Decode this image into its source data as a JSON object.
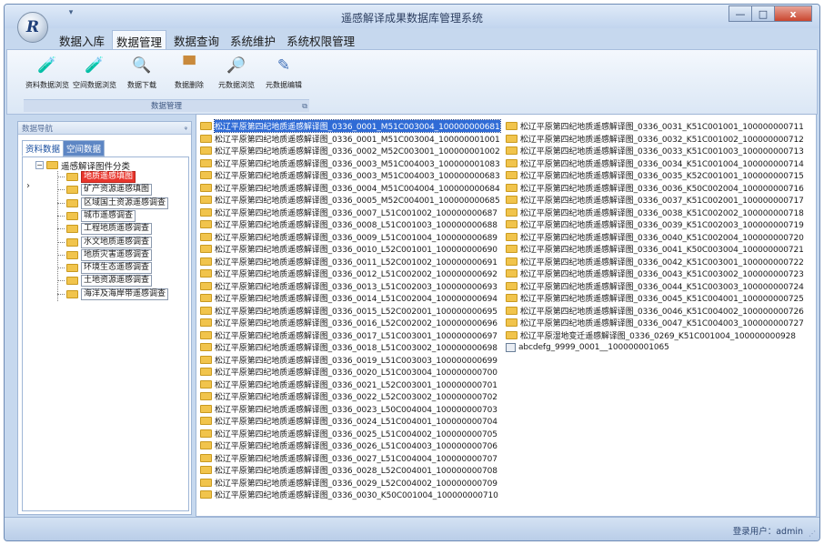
{
  "app": {
    "title": "遥感解译成果数据库管理系统",
    "logo_text": "R"
  },
  "window_buttons": {
    "minimize": "—",
    "maximize": "□",
    "close": "x"
  },
  "menu": {
    "items": [
      {
        "label": "数据入库",
        "active": false
      },
      {
        "label": "数据管理",
        "active": true
      },
      {
        "label": "数据查询",
        "active": false
      },
      {
        "label": "系统维护",
        "active": false
      },
      {
        "label": "系统权限管理",
        "active": false
      }
    ]
  },
  "ribbon": {
    "group_label": "数据管理",
    "tools": [
      {
        "label": "资料数据浏览",
        "icon": "data-browse-icon",
        "glyph": "🧪",
        "color": "#3f8f3f"
      },
      {
        "label": "空间数据浏览",
        "icon": "spatial-browse-icon",
        "glyph": "🧪",
        "color": "#3f8f3f"
      },
      {
        "label": "数据下载",
        "icon": "download-icon",
        "glyph": "🔍",
        "color": "#4f6f9f"
      },
      {
        "label": "数据删除",
        "icon": "delete-icon",
        "glyph": "▀",
        "color": "#c98a3c"
      },
      {
        "label": "元数据浏览",
        "icon": "metadata-browse-icon",
        "glyph": "🔎",
        "color": "#4f8f4f"
      },
      {
        "label": "元数据编辑",
        "icon": "metadata-edit-icon",
        "glyph": "✎",
        "color": "#3f6fb8"
      }
    ]
  },
  "nav": {
    "header": "数据导航",
    "pin": "ᵩ",
    "tabs": [
      "资料数据",
      "空间数据"
    ],
    "tree_root": "遥感解译图件分类",
    "tree_items": [
      {
        "label": "地质遥感填图",
        "selected": true
      },
      {
        "label": "矿产资源遥感填图",
        "selected": false
      },
      {
        "label": "区域国土资源遥感调查",
        "selected": false
      },
      {
        "label": "城市遥感调查",
        "selected": false
      },
      {
        "label": "工程地质遥感调查",
        "selected": false
      },
      {
        "label": "水文地质遥感调查",
        "selected": false
      },
      {
        "label": "地质灾害遥感调查",
        "selected": false
      },
      {
        "label": "环境生态遥感调查",
        "selected": false
      },
      {
        "label": "土地资源遥感调查",
        "selected": false
      },
      {
        "label": "海洋及海岸带遥感调查",
        "selected": false
      }
    ]
  },
  "files": {
    "column_1": [
      {
        "name": "松辽平原第四纪地质遥感解译图_0336_0001_M51C003004_100000000681",
        "type": "folder",
        "highlighted": true
      },
      {
        "name": "松辽平原第四纪地质遥感解译图_0336_0001_M51C003004_100000001001",
        "type": "folder"
      },
      {
        "name": "松辽平原第四纪地质遥感解译图_0336_0002_M52C003001_100000001002",
        "type": "folder"
      },
      {
        "name": "松辽平原第四纪地质遥感解译图_0336_0003_M51C004003_100000001083",
        "type": "folder"
      },
      {
        "name": "松辽平原第四纪地质遥感解译图_0336_0003_M51C004003_100000000683",
        "type": "folder"
      },
      {
        "name": "松辽平原第四纪地质遥感解译图_0336_0004_M51C004004_100000000684",
        "type": "folder"
      },
      {
        "name": "松辽平原第四纪地质遥感解译图_0336_0005_M52C004001_100000000685",
        "type": "folder"
      },
      {
        "name": "松辽平原第四纪地质遥感解译图_0336_0007_L51C001002_100000000687",
        "type": "folder"
      },
      {
        "name": "松辽平原第四纪地质遥感解译图_0336_0008_L51C001003_100000000688",
        "type": "folder"
      },
      {
        "name": "松辽平原第四纪地质遥感解译图_0336_0009_L51C001004_100000000689",
        "type": "folder"
      },
      {
        "name": "松辽平原第四纪地质遥感解译图_0336_0010_L52C001001_100000000690",
        "type": "folder"
      },
      {
        "name": "松辽平原第四纪地质遥感解译图_0336_0011_L52C001002_100000000691",
        "type": "folder"
      },
      {
        "name": "松辽平原第四纪地质遥感解译图_0336_0012_L51C002002_100000000692",
        "type": "folder"
      },
      {
        "name": "松辽平原第四纪地质遥感解译图_0336_0013_L51C002003_100000000693",
        "type": "folder"
      },
      {
        "name": "松辽平原第四纪地质遥感解译图_0336_0014_L51C002004_100000000694",
        "type": "folder"
      },
      {
        "name": "松辽平原第四纪地质遥感解译图_0336_0015_L52C002001_100000000695",
        "type": "folder"
      },
      {
        "name": "松辽平原第四纪地质遥感解译图_0336_0016_L52C002002_100000000696",
        "type": "folder"
      },
      {
        "name": "松辽平原第四纪地质遥感解译图_0336_0017_L51C003001_100000000697",
        "type": "folder"
      },
      {
        "name": "松辽平原第四纪地质遥感解译图_0336_0018_L51C003002_100000000698",
        "type": "folder"
      },
      {
        "name": "松辽平原第四纪地质遥感解译图_0336_0019_L51C003003_100000000699",
        "type": "folder"
      },
      {
        "name": "松辽平原第四纪地质遥感解译图_0336_0020_L51C003004_100000000700",
        "type": "folder"
      },
      {
        "name": "松辽平原第四纪地质遥感解译图_0336_0021_L52C003001_100000000701",
        "type": "folder"
      },
      {
        "name": "松辽平原第四纪地质遥感解译图_0336_0022_L52C003002_100000000702",
        "type": "folder"
      },
      {
        "name": "松辽平原第四纪地质遥感解译图_0336_0023_L50C004004_100000000703",
        "type": "folder"
      },
      {
        "name": "松辽平原第四纪地质遥感解译图_0336_0024_L51C004001_100000000704",
        "type": "folder"
      },
      {
        "name": "松辽平原第四纪地质遥感解译图_0336_0025_L51C004002_100000000705",
        "type": "folder"
      },
      {
        "name": "松辽平原第四纪地质遥感解译图_0336_0026_L51C004003_100000000706",
        "type": "folder"
      },
      {
        "name": "松辽平原第四纪地质遥感解译图_0336_0027_L51C004004_100000000707",
        "type": "folder"
      },
      {
        "name": "松辽平原第四纪地质遥感解译图_0336_0028_L52C004001_100000000708",
        "type": "folder"
      },
      {
        "name": "松辽平原第四纪地质遥感解译图_0336_0029_L52C004002_100000000709",
        "type": "folder"
      },
      {
        "name": "松辽平原第四纪地质遥感解译图_0336_0030_K50C001004_100000000710",
        "type": "folder"
      }
    ],
    "column_2": [
      {
        "name": "松辽平原第四纪地质遥感解译图_0336_0031_K51C001001_100000000711",
        "type": "folder"
      },
      {
        "name": "松辽平原第四纪地质遥感解译图_0336_0032_K51C001002_100000000712",
        "type": "folder"
      },
      {
        "name": "松辽平原第四纪地质遥感解译图_0336_0033_K51C001003_100000000713",
        "type": "folder"
      },
      {
        "name": "松辽平原第四纪地质遥感解译图_0336_0034_K51C001004_100000000714",
        "type": "folder"
      },
      {
        "name": "松辽平原第四纪地质遥感解译图_0336_0035_K52C001001_100000000715",
        "type": "folder"
      },
      {
        "name": "松辽平原第四纪地质遥感解译图_0336_0036_K50C002004_100000000716",
        "type": "folder"
      },
      {
        "name": "松辽平原第四纪地质遥感解译图_0336_0037_K51C002001_100000000717",
        "type": "folder"
      },
      {
        "name": "松辽平原第四纪地质遥感解译图_0336_0038_K51C002002_100000000718",
        "type": "folder"
      },
      {
        "name": "松辽平原第四纪地质遥感解译图_0336_0039_K51C002003_100000000719",
        "type": "folder"
      },
      {
        "name": "松辽平原第四纪地质遥感解译图_0336_0040_K51C002004_100000000720",
        "type": "folder"
      },
      {
        "name": "松辽平原第四纪地质遥感解译图_0336_0041_K50C003004_100000000721",
        "type": "folder"
      },
      {
        "name": "松辽平原第四纪地质遥感解译图_0336_0042_K51C003001_100000000722",
        "type": "folder"
      },
      {
        "name": "松辽平原第四纪地质遥感解译图_0336_0043_K51C003002_100000000723",
        "type": "folder"
      },
      {
        "name": "松辽平原第四纪地质遥感解译图_0336_0044_K51C003003_100000000724",
        "type": "folder"
      },
      {
        "name": "松辽平原第四纪地质遥感解译图_0336_0045_K51C004001_100000000725",
        "type": "folder"
      },
      {
        "name": "松辽平原第四纪地质遥感解译图_0336_0046_K51C004002_100000000726",
        "type": "folder"
      },
      {
        "name": "松辽平原第四纪地质遥感解译图_0336_0047_K51C004003_100000000727",
        "type": "folder"
      },
      {
        "name": "松辽平原湿地变迁遥感解译图_0336_0269_K51C001004_100000000928",
        "type": "folder"
      },
      {
        "name": "abcdefg_9999_0001__100000001065",
        "type": "document"
      }
    ]
  },
  "status": {
    "text": "登录用户：admin"
  },
  "colors": {
    "accent": "#2f6bd6",
    "selected_tree": "#e8352c",
    "folder": "#f1c44c",
    "chrome": "#c6d8ee"
  }
}
